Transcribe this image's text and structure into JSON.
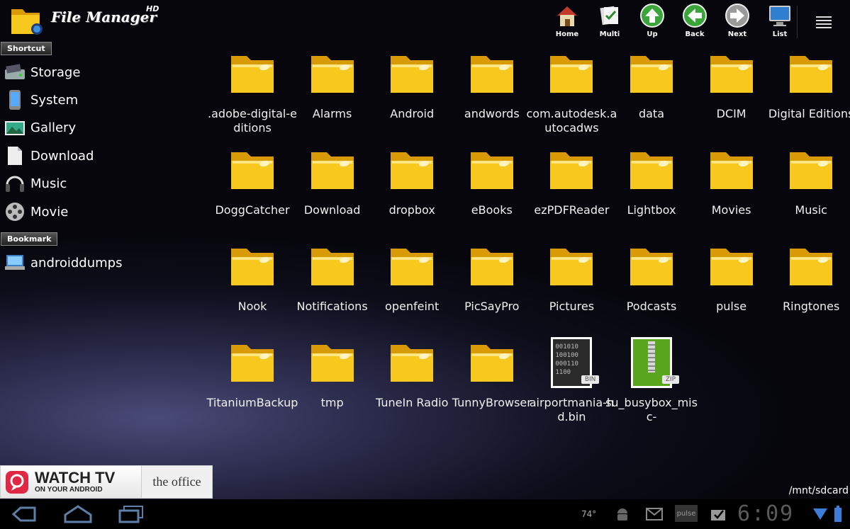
{
  "app": {
    "title": "File Manager",
    "badge": "HD"
  },
  "sidebar": {
    "shortcut_label": "Shortcut",
    "shortcuts": [
      {
        "label": "Storage",
        "icon": "storage-icon"
      },
      {
        "label": "System",
        "icon": "system-icon"
      },
      {
        "label": "Gallery",
        "icon": "gallery-icon"
      },
      {
        "label": "Download",
        "icon": "download-icon"
      },
      {
        "label": "Music",
        "icon": "music-icon"
      },
      {
        "label": "Movie",
        "icon": "movie-icon"
      }
    ],
    "bookmark_label": "Bookmark",
    "bookmarks": [
      {
        "label": "androiddumps",
        "icon": "network-icon"
      }
    ]
  },
  "toolbar": {
    "home": "Home",
    "multi": "Multi",
    "up": "Up",
    "back": "Back",
    "next": "Next",
    "list": "List"
  },
  "files": [
    {
      "name": ".adobe-digital-editions",
      "type": "folder"
    },
    {
      "name": "Alarms",
      "type": "folder"
    },
    {
      "name": "Android",
      "type": "folder"
    },
    {
      "name": "andwords",
      "type": "folder"
    },
    {
      "name": "com.autodesk.autocadws",
      "type": "folder"
    },
    {
      "name": "data",
      "type": "folder"
    },
    {
      "name": "DCIM",
      "type": "folder"
    },
    {
      "name": "Digital Editions",
      "type": "folder"
    },
    {
      "name": "DoggCatcher",
      "type": "folder"
    },
    {
      "name": "Download",
      "type": "folder"
    },
    {
      "name": "dropbox",
      "type": "folder"
    },
    {
      "name": "eBooks",
      "type": "folder"
    },
    {
      "name": "ezPDFReader",
      "type": "folder"
    },
    {
      "name": "Lightbox",
      "type": "folder"
    },
    {
      "name": "Movies",
      "type": "folder"
    },
    {
      "name": "Music",
      "type": "folder"
    },
    {
      "name": "Nook",
      "type": "folder"
    },
    {
      "name": "Notifications",
      "type": "folder"
    },
    {
      "name": "openfeint",
      "type": "folder"
    },
    {
      "name": "PicSayPro",
      "type": "folder"
    },
    {
      "name": "Pictures",
      "type": "folder"
    },
    {
      "name": "Podcasts",
      "type": "folder"
    },
    {
      "name": "pulse",
      "type": "folder"
    },
    {
      "name": "Ringtones",
      "type": "folder"
    },
    {
      "name": "TitaniumBackup",
      "type": "folder"
    },
    {
      "name": "tmp",
      "type": "folder"
    },
    {
      "name": "TuneIn Radio",
      "type": "folder"
    },
    {
      "name": "TunnyBrowser",
      "type": "folder"
    },
    {
      "name": "airportmania-hd.bin",
      "type": "bin",
      "badge": "BIN",
      "lines": [
        "001010",
        "100100",
        "000110",
        "1100"
      ]
    },
    {
      "name": "su_busybox_misc-",
      "type": "zip",
      "badge": "ZIP"
    }
  ],
  "ad": {
    "headline": "WATCH TV",
    "subline": "ON YOUR ANDROID",
    "show": "the office"
  },
  "status": {
    "path": "/mnt/sdcard",
    "temperature": "74°",
    "time": "6:09",
    "pulse_label": "pulse"
  },
  "colors": {
    "folder": "#f7c81e",
    "folder_dark": "#d99a08",
    "zip_green": "#5aa51e"
  }
}
